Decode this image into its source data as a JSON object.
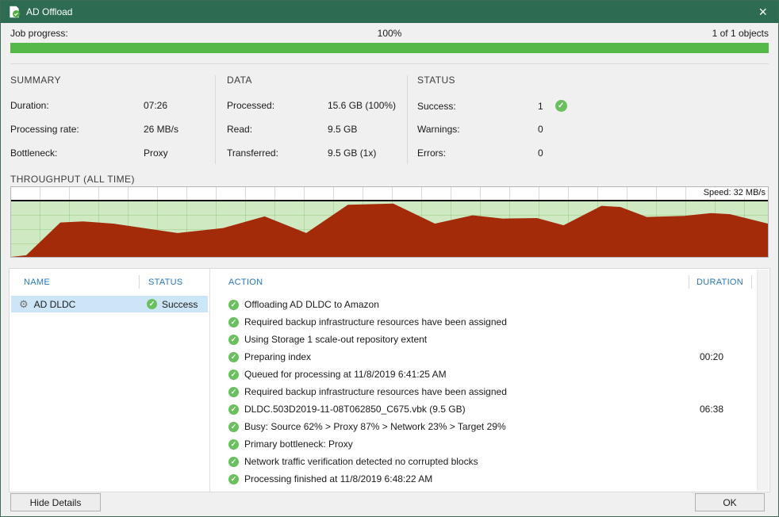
{
  "window": {
    "title": "AD Offload"
  },
  "icons": {
    "close": "×",
    "check": "✓",
    "gear": "⚙",
    "job": "job-document-arrow-icon"
  },
  "progress": {
    "label": "Job progress:",
    "percent": "100%",
    "objects": "1 of 1 objects",
    "value": 100
  },
  "summary": {
    "title": "SUMMARY",
    "rows": [
      {
        "label": "Duration:",
        "value": "07:26"
      },
      {
        "label": "Processing rate:",
        "value": "26 MB/s"
      },
      {
        "label": "Bottleneck:",
        "value": "Proxy"
      }
    ]
  },
  "data_panel": {
    "title": "DATA",
    "rows": [
      {
        "label": "Processed:",
        "value": "15.6 GB (100%)"
      },
      {
        "label": "Read:",
        "value": "9.5 GB"
      },
      {
        "label": "Transferred:",
        "value": "9.5 GB (1x)"
      }
    ]
  },
  "status_panel": {
    "title": "STATUS",
    "rows": [
      {
        "label": "Success:",
        "value": "1",
        "icon": "success-check-icon"
      },
      {
        "label": "Warnings:",
        "value": "0",
        "icon": ""
      },
      {
        "label": "Errors:",
        "value": "0",
        "icon": ""
      }
    ]
  },
  "throughput": {
    "title": "THROUGHPUT (ALL TIME)"
  },
  "chart_data": {
    "type": "area",
    "title": "THROUGHPUT (ALL TIME)",
    "speed_label": "Speed: 32 MB/s",
    "series": [
      {
        "name": "Speed",
        "unit": "MB/s",
        "current": 32
      }
    ],
    "legend_position": "top-right",
    "axes": "unlabeled; values normalized as percent of plot area (y measured from top)",
    "colors": {
      "area": "#a32b0a",
      "plot_bg": "#cfe9c2",
      "top_band": "#ffffff",
      "baseline": "#141414"
    },
    "points_pct": [
      [
        0,
        100
      ],
      [
        2,
        97
      ],
      [
        6.5,
        38
      ],
      [
        9.5,
        36
      ],
      [
        13.5,
        40
      ],
      [
        22,
        57
      ],
      [
        28,
        48
      ],
      [
        33.5,
        27
      ],
      [
        39,
        57
      ],
      [
        44.5,
        6
      ],
      [
        50.5,
        4
      ],
      [
        56,
        40
      ],
      [
        61,
        25
      ],
      [
        65,
        31
      ],
      [
        69.5,
        30
      ],
      [
        73,
        43
      ],
      [
        78,
        8
      ],
      [
        80.5,
        10
      ],
      [
        84,
        28
      ],
      [
        89,
        26
      ],
      [
        92.5,
        21
      ],
      [
        95,
        23
      ],
      [
        100,
        40
      ],
      [
        100,
        100
      ]
    ]
  },
  "table": {
    "headers": {
      "name": "NAME",
      "status": "STATUS"
    },
    "rows": [
      {
        "name": "AD DLDC",
        "status": "Success"
      }
    ]
  },
  "actions": {
    "headers": {
      "action": "ACTION",
      "duration": "DURATION"
    },
    "rows": [
      {
        "text": "Offloading AD DLDC to Amazon",
        "duration": ""
      },
      {
        "text": "Required backup infrastructure resources have been assigned",
        "duration": ""
      },
      {
        "text": "Using Storage 1 scale-out repository extent",
        "duration": ""
      },
      {
        "text": "Preparing index",
        "duration": "00:20"
      },
      {
        "text": "Queued for processing at 11/8/2019 6:41:25 AM",
        "duration": ""
      },
      {
        "text": "Required backup infrastructure resources have been assigned",
        "duration": ""
      },
      {
        "text": "DLDC.503D2019-11-08T062850_C675.vbk (9.5 GB)",
        "duration": "06:38"
      },
      {
        "text": "Busy: Source 62% > Proxy 87% > Network 23% > Target 29%",
        "duration": ""
      },
      {
        "text": "Primary bottleneck: Proxy",
        "duration": ""
      },
      {
        "text": "Network traffic verification detected no corrupted blocks",
        "duration": ""
      },
      {
        "text": "Processing finished at 11/8/2019 6:48:22 AM",
        "duration": ""
      }
    ]
  },
  "footer": {
    "hide_details": "Hide Details",
    "ok": "OK"
  },
  "colors": {
    "titlebar": "#2d6b52",
    "accent_blue": "#2878bd",
    "success_green": "#6abf5e",
    "progress_green": "#54b948"
  }
}
